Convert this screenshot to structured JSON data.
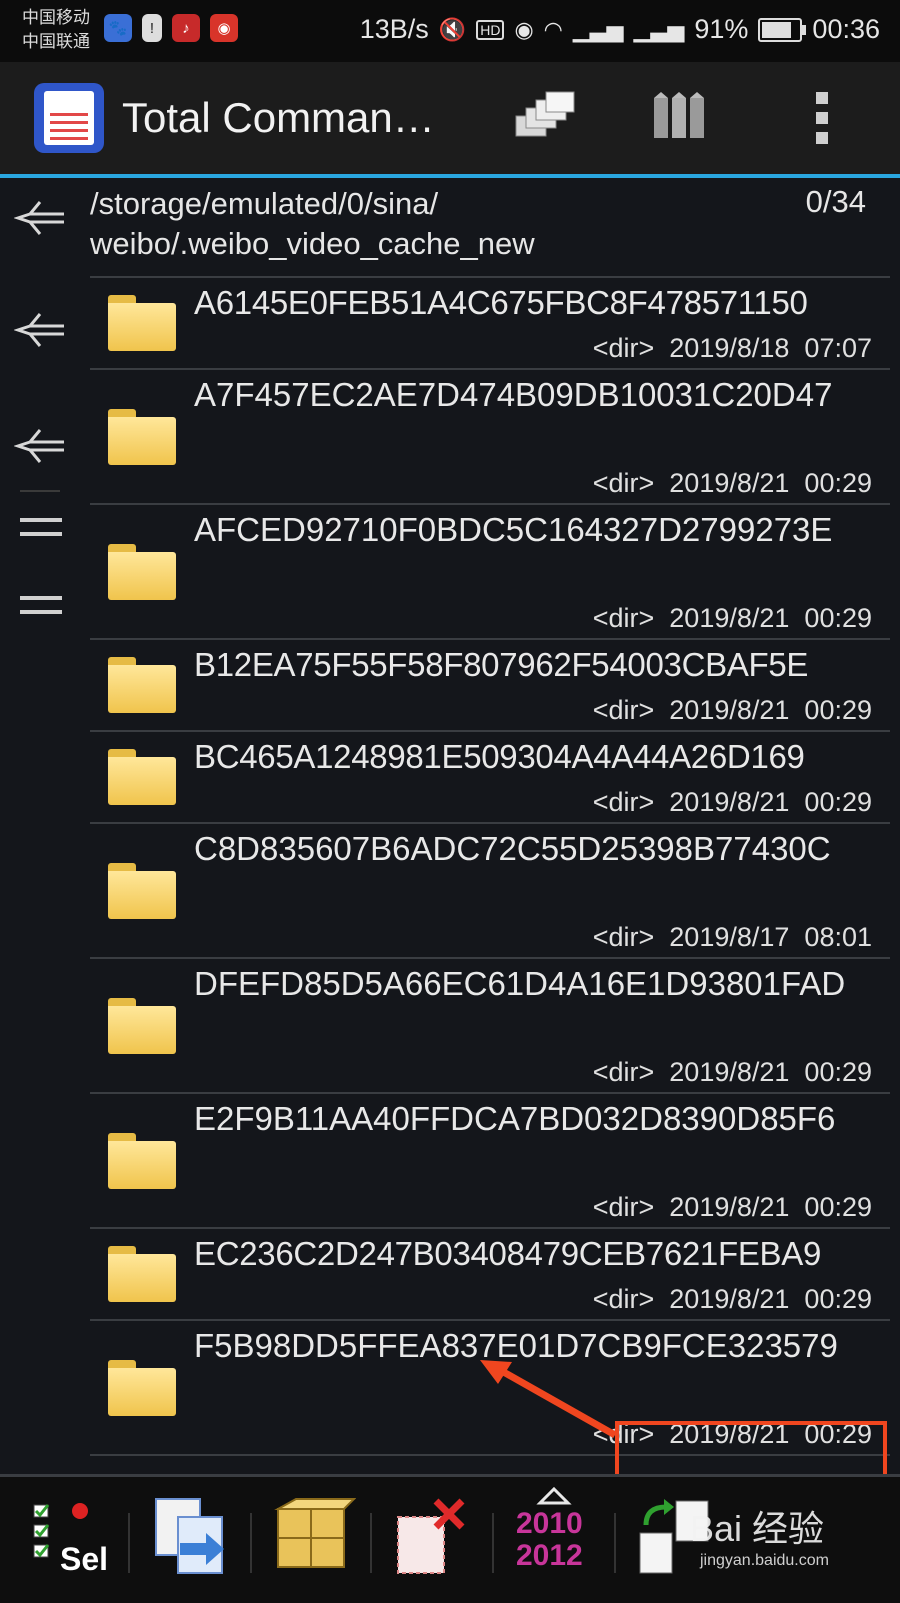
{
  "status_bar": {
    "carrier_1": "中国移动",
    "carrier_2": "中国联通",
    "net_speed": "13B/s",
    "battery": "91%",
    "battery_level": 0.91,
    "time": "00:36",
    "icons": [
      "baidu-icon",
      "alert-icon",
      "music-icon",
      "weibo-icon",
      "mute-icon",
      "hd-icon",
      "eye-icon",
      "wifi-icon",
      "signal-4g-icon",
      "signal-2g-icon"
    ]
  },
  "titlebar": {
    "title": "Total Comman…"
  },
  "path": {
    "line1": "/storage/emulated/0/sina/",
    "line2": "weibo/.weibo_video_cache_new",
    "count": "0/34"
  },
  "files": [
    {
      "name": "A6145E0FEB51A4C675FBC8F478571150",
      "type": "<dir>",
      "date": "2019/8/18",
      "time": "07:07"
    },
    {
      "name": "A7F457EC2AE7D474B09DB10031C20D47",
      "type": "<dir>",
      "date": "2019/8/21",
      "time": "00:29"
    },
    {
      "name": "AFCED92710F0BDC5C164327D2799273E",
      "type": "<dir>",
      "date": "2019/8/21",
      "time": "00:29"
    },
    {
      "name": "B12EA75F55F58F807962F54003CBAF5E",
      "type": "<dir>",
      "date": "2019/8/21",
      "time": "00:29"
    },
    {
      "name": "BC465A1248981E509304A4A44A26D169",
      "type": "<dir>",
      "date": "2019/8/21",
      "time": "00:29"
    },
    {
      "name": "C8D835607B6ADC72C55D25398B77430C",
      "type": "<dir>",
      "date": "2019/8/17",
      "time": "08:01"
    },
    {
      "name": "DFEFD85D5A66EC61D4A16E1D93801FAD",
      "type": "<dir>",
      "date": "2019/8/21",
      "time": "00:29"
    },
    {
      "name": "E2F9B11AA40FFDCA7BD032D8390D85F6",
      "type": "<dir>",
      "date": "2019/8/21",
      "time": "00:29"
    },
    {
      "name": "EC236C2D247B03408479CEB7621FEBA9",
      "type": "<dir>",
      "date": "2019/8/21",
      "time": "00:29"
    },
    {
      "name": "F5B98DD5FFEA837E01D7CB9FCE323579",
      "type": "<dir>",
      "date": "2019/8/21",
      "time": "00:29"
    }
  ],
  "bottom_bar": {
    "select_label": "Sel",
    "year_top": "2010",
    "year_bottom": "2012"
  },
  "watermark": {
    "brand": "Bai 经验",
    "url": "jingyan.baidu.com"
  },
  "colors": {
    "accent": "#2aa7e0",
    "highlight": "#f0461f",
    "folder": "#f0c44c"
  }
}
